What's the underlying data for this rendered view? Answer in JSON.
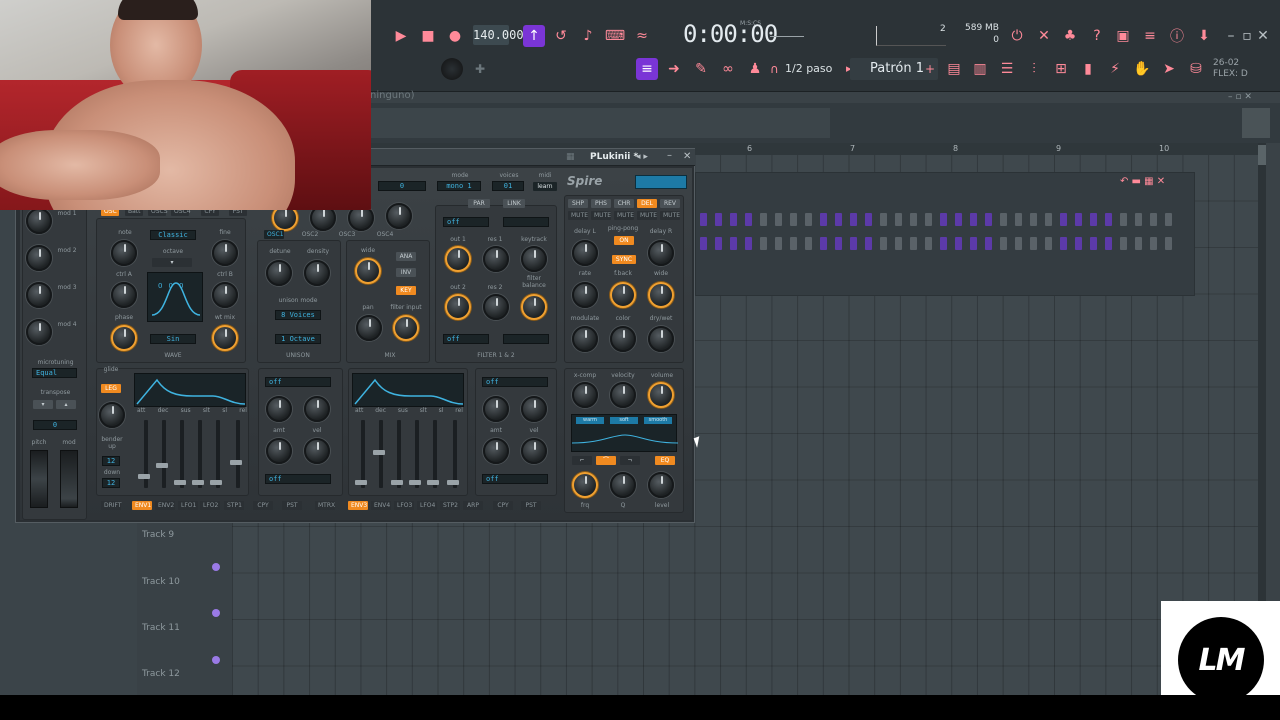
{
  "colors": {
    "accent": "#ff8a99",
    "purple": "#7a35d6",
    "knob_orange": "#f0a030",
    "lcd_blue": "#3fb3e0"
  },
  "toolbar": {
    "tempo": "140.000",
    "time": "0:00:00",
    "time_unit": "M:S:CS",
    "mem": "589 MB",
    "mem_sub": "0",
    "counter": "2",
    "step": "1/2 paso",
    "pattern": "Patrón 1",
    "flex_date": "26-02",
    "flex_label": "FLEX: D",
    "icons": [
      "play-icon",
      "stop-icon",
      "record-icon",
      "metronome-icon",
      "countdown-icon",
      "typing-keyboard-icon",
      "step-edit-icon",
      "blend-icon",
      "loop-icon"
    ]
  },
  "breadcrumb": "ninguno)",
  "ruler": [
    "6",
    "7",
    "8",
    "9",
    "10"
  ],
  "tracks": [
    "Track 9",
    "Track 10",
    "Track 11",
    "Track 12"
  ],
  "plugin": {
    "title": "PLukinii *",
    "brand": "Spire",
    "header": {
      "mode_label": "mode",
      "mode_value": "mono 1",
      "voices_label": "voices",
      "voices_value": "01",
      "midi_label": "midi",
      "midi_value": "learn",
      "preset_value": "0"
    },
    "osc_tabs": [
      "OSC1",
      "OSC2",
      "OSC3",
      "OSC4"
    ],
    "top_tabs": [
      "OSC",
      "Batt",
      "OSCS",
      "OSC4",
      "CPY",
      "PST"
    ],
    "mod_labels": [
      "mod 1",
      "mod 2",
      "mod 3",
      "mod 4"
    ],
    "microtuning_label": "microtuning",
    "microtuning_value": "Equal",
    "transpose_label": "transpose",
    "transpose_value": "0",
    "pitch_label": "pitch",
    "mod_label": "mod",
    "wave": {
      "note": "note",
      "fine": "fine",
      "wave_value": "Classic",
      "octave": "octave",
      "ctrl_a": "ctrl A",
      "ctrl_b": "ctrl B",
      "phase": "phase",
      "wt_mix": "wt mix",
      "shape": "Sin",
      "section": "WAVE",
      "oct_vals": [
        "0",
        "0",
        "0"
      ]
    },
    "unison": {
      "detune": "detune",
      "density": "density",
      "mode_label": "unison mode",
      "mode_value": "8 Voices",
      "oct_value": "1 Octave",
      "section": "UNISON"
    },
    "mix": {
      "wide": "wide",
      "ana": "ANA",
      "inv": "INV",
      "key": "KEY",
      "pan": "pan",
      "filter_input": "filter input",
      "section": "MIX"
    },
    "filter": {
      "par": "PAR",
      "link": "LINK",
      "off1": "off",
      "out1": "out 1",
      "res1": "res 1",
      "keytrack": "keytrack",
      "filter_balance": "filter balance",
      "out2": "out 2",
      "res2": "res 2",
      "off2": "off",
      "section": "FILTER 1 & 2"
    },
    "fx_tabs": [
      "SHP",
      "PHS",
      "CHR",
      "DEL",
      "REV"
    ],
    "mute": [
      "MUTE",
      "MUTE",
      "MUTE",
      "MUTE",
      "MUTE"
    ],
    "delay": {
      "delay_l": "delay L",
      "ping_pong": "ping-pong",
      "delay_r": "delay R",
      "on": "ON",
      "sync": "SYNC",
      "rate": "rate",
      "fback": "f.back",
      "wide": "wide",
      "modulate": "modulate",
      "color": "color",
      "dry_wet": "dry/wet"
    },
    "env1": {
      "glide": "glide",
      "legato": "LEG",
      "adsr": [
        "att",
        "dec",
        "sus",
        "slt",
        "sl",
        "rel"
      ],
      "off_a": "off",
      "amt": "amt",
      "vel": "vel",
      "off_b": "off",
      "bender_up": "bender up",
      "bender_up_val": "12",
      "down": "down",
      "down_val": "12"
    },
    "env2": {
      "adsr": [
        "att",
        "dec",
        "sus",
        "slt",
        "sl",
        "rel"
      ],
      "off_a": "off",
      "amt": "amt",
      "vel": "vel",
      "off_b": "off"
    },
    "master": {
      "xcomp": "x-comp",
      "velocity": "velocity",
      "volume": "volume",
      "eq": "EQ",
      "frq": "frq",
      "q": "Q",
      "level": "level",
      "eq_tabs": [
        "warm",
        "soft",
        "smooth"
      ]
    },
    "bottom_tabs": [
      "DRIFT",
      "ENV1",
      "ENV2",
      "LFO1",
      "LFO2",
      "STP1",
      "CPY",
      "PST",
      "MTRX",
      "ENV3",
      "ENV4",
      "LFO3",
      "LFO4",
      "STP2",
      "ARP",
      "CPY",
      "PST"
    ]
  }
}
